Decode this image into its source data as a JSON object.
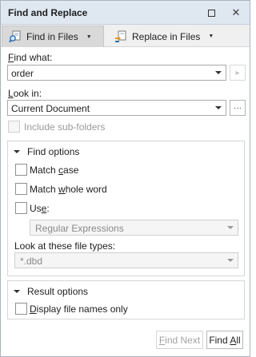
{
  "window": {
    "title": "Find and Replace"
  },
  "titlebar": {
    "restore_glyph": "□",
    "close_glyph": "✕"
  },
  "tabs": [
    {
      "label": "Find in Files",
      "icon": "find-in-files-icon",
      "active": true
    },
    {
      "label": "Replace in Files",
      "icon": "replace-in-files-icon",
      "active": false
    }
  ],
  "find_what": {
    "label_underlined": "F",
    "label_rest": "ind what:",
    "value": "order"
  },
  "look_in": {
    "label_underlined": "L",
    "label_rest": "ook in:",
    "value": "Current Document",
    "browse_label": "···"
  },
  "include_subfolders": {
    "label": "Include sub-folders",
    "checked": false,
    "enabled": false
  },
  "find_options": {
    "header": "Find options",
    "match_case": {
      "pre": "Match ",
      "underlined": "c",
      "post": "ase",
      "checked": false
    },
    "match_whole_word": {
      "pre": "Match ",
      "underlined": "w",
      "post": "hole word",
      "checked": false
    },
    "use": {
      "pre": "Us",
      "underlined": "e",
      "post": ":",
      "checked": false
    },
    "use_type": "Regular Expressions",
    "file_types_label": "Look at these file types:",
    "file_types_value": "*.dbd"
  },
  "result_options": {
    "header": "Result options",
    "display_file_names_only": {
      "underlined": "D",
      "rest": "isplay file names only",
      "checked": false
    }
  },
  "buttons": {
    "find_next": {
      "underlined": "F",
      "rest": "ind Next",
      "enabled": false
    },
    "find_all": {
      "pre": "Find ",
      "underlined": "A",
      "post": "ll",
      "enabled": true
    }
  },
  "colors": {
    "titlebar_bg": "#dfe7f1",
    "active_tab_bg": "#d9d9d9",
    "window_border": "#a9b3c1"
  }
}
